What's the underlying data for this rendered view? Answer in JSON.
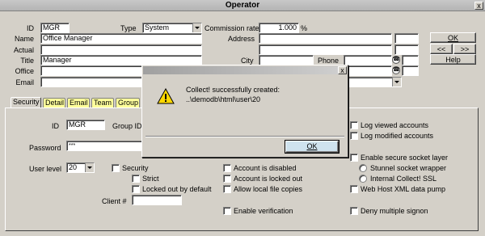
{
  "window": {
    "title": "Operator"
  },
  "header": {
    "id_label": "ID",
    "id_value": "MGR",
    "type_label": "Type",
    "type_value": "System",
    "commission_label": "Commission rate",
    "commission_value": "1.000",
    "commission_unit": "%",
    "name_label": "Name",
    "name_value": "Office Manager",
    "actual_label": "Actual",
    "actual_value": "",
    "title_label": "Title",
    "title_value": "Manager",
    "office_label": "Office",
    "office_value": "",
    "email_label": "Email",
    "email_value": "",
    "address_label": "Address",
    "city_label": "City",
    "phone_label": "Phone"
  },
  "buttons": {
    "ok": "OK",
    "prev": "<<",
    "next": ">>",
    "help": "Help"
  },
  "tabs": [
    "Security",
    "Detail",
    "Email",
    "Team",
    "Group"
  ],
  "security": {
    "id_label": "ID",
    "id_value": "MGR",
    "group_id_label": "Group ID",
    "password_label": "Password",
    "password_value": "***",
    "user_level_label": "User level",
    "user_level_value": "20",
    "security_label": "Security",
    "strict_label": "Strict",
    "locked_default_label": "Locked out by default",
    "client_label": "Client #",
    "account_disabled_label": "Account is disabled",
    "account_locked_label": "Account is locked out",
    "allow_local_label": "Allow local file copies",
    "enable_verification_label": "Enable verification",
    "log_viewed_label": "Log viewed accounts",
    "log_modified_label": "Log modified accounts",
    "enable_ssl_label": "Enable secure socket layer",
    "stunnel_label": "Stunnel socket wrapper",
    "internal_ssl_label": "Internal Collect! SSL",
    "web_host_label": "Web Host XML data pump",
    "deny_multi_label": "Deny multiple signon"
  },
  "dialog": {
    "line1": "Collect! successfully created:",
    "line2": "..\\demodb\\html\\user\\20",
    "ok_label": "OK",
    "icon": "warning-icon"
  }
}
